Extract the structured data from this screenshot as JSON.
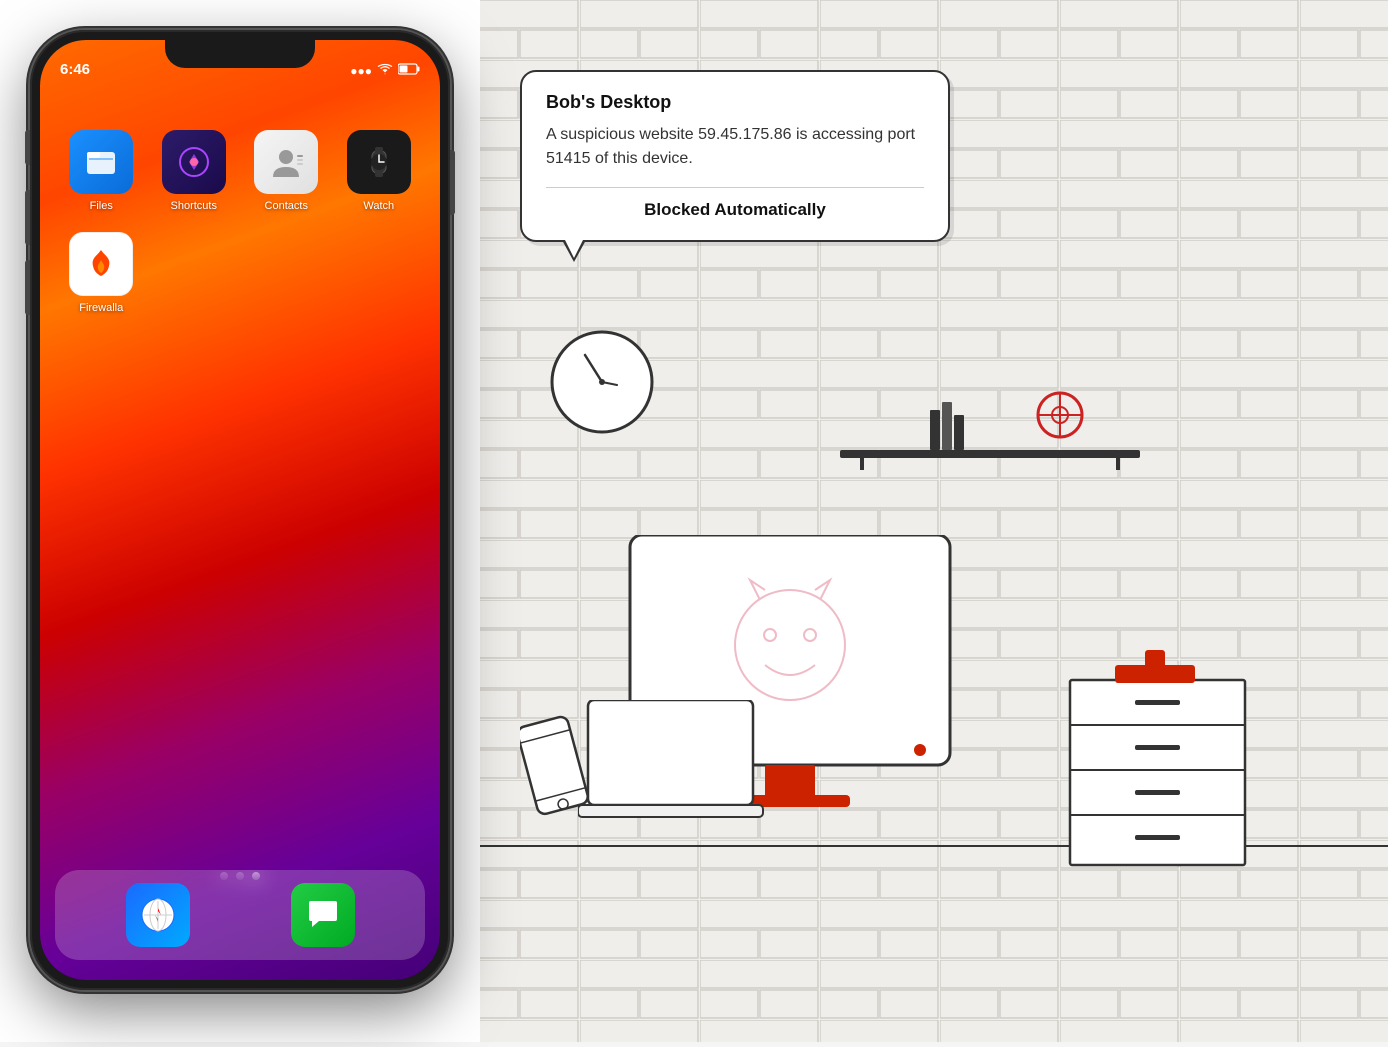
{
  "phone": {
    "time": "6:46",
    "apps": [
      {
        "name": "Files",
        "label": "Files",
        "icon_type": "files"
      },
      {
        "name": "Shortcuts",
        "label": "Shortcuts",
        "icon_type": "shortcuts"
      },
      {
        "name": "Contacts",
        "label": "Contacts",
        "icon_type": "contacts"
      },
      {
        "name": "Watch",
        "label": "Watch",
        "icon_type": "watch"
      },
      {
        "name": "Firewalla",
        "label": "Firewalla",
        "icon_type": "firewalla"
      }
    ],
    "dock": [
      {
        "name": "Safari",
        "icon_type": "safari"
      },
      {
        "name": "Messages",
        "icon_type": "messages"
      }
    ]
  },
  "notification": {
    "title": "Bob's Desktop",
    "body": "A suspicious website 59.45.175.86 is accessing port 51415 of this device.",
    "action": "Blocked Automatically"
  },
  "illustration": {
    "has_clock": true,
    "has_shelf": true,
    "has_desktop": true,
    "has_dresser": true
  }
}
